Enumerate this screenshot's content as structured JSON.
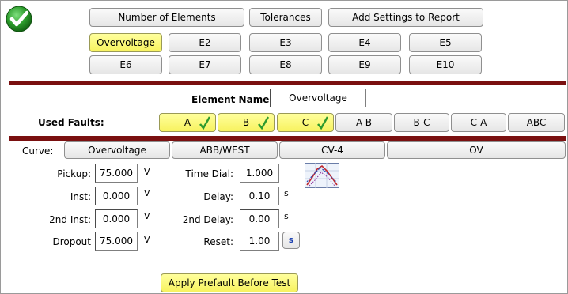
{
  "status": {
    "icon": "checkmark-icon",
    "color": "#1e8c1e"
  },
  "top_tabs": {
    "number_of_elements": "Number of Elements",
    "tolerances": "Tolerances",
    "add_settings": "Add Settings to Report"
  },
  "elements": [
    "Overvoltage",
    "E2",
    "E3",
    "E4",
    "E5",
    "E6",
    "E7",
    "E8",
    "E9",
    "E10"
  ],
  "element_name": {
    "label": "Element Name:",
    "value": "Overvoltage"
  },
  "used_faults": {
    "label": "Used Faults:",
    "items": [
      {
        "label": "A",
        "checked": true
      },
      {
        "label": "B",
        "checked": true
      },
      {
        "label": "C",
        "checked": true
      },
      {
        "label": "A-B",
        "checked": false
      },
      {
        "label": "B-C",
        "checked": false
      },
      {
        "label": "C-A",
        "checked": false
      },
      {
        "label": "ABC",
        "checked": false
      }
    ]
  },
  "curve": {
    "label": "Curve:",
    "type": "Overvoltage",
    "manufacturer": "ABB/WEST",
    "model": "CV-4",
    "function": "OV"
  },
  "settings_left": [
    {
      "label": "Pickup:",
      "value": "75.000",
      "unit": "V"
    },
    {
      "label": "Inst:",
      "value": "0.000",
      "unit": "V"
    },
    {
      "label": "2nd Inst:",
      "value": "0.000",
      "unit": "V"
    },
    {
      "label": "Dropout",
      "value": "75.000",
      "unit": "V"
    }
  ],
  "settings_right": [
    {
      "label": "Time Dial:",
      "value": "1.000",
      "unit": ""
    },
    {
      "label": "Delay:",
      "value": "0.10",
      "unit": "s"
    },
    {
      "label": "2nd Delay:",
      "value": "0.00",
      "unit": "s"
    },
    {
      "label": "Reset:",
      "value": "1.00",
      "unit": "s"
    }
  ],
  "curve_icon": "curve-plot-icon",
  "apply_prefault": "Apply Prefault Before Test",
  "colors": {
    "accent_yellow": "#f7f25f",
    "divider": "#7a1010",
    "check_green": "#2e9a2e",
    "unit_blue": "#1a3fb0"
  }
}
